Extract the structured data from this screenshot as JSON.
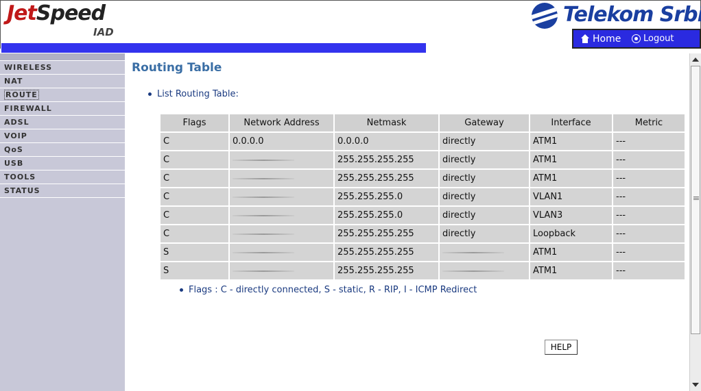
{
  "header": {
    "logo_main_a": "Jet",
    "logo_main_b": "Speed",
    "logo_sub": "IAD",
    "brand": "Telekom Srbija",
    "nav": {
      "home": "Home",
      "logout": "Logout"
    },
    "colors": {
      "bar": "#3333ee",
      "brand": "#1a3fa0",
      "logo_accent": "#c01818"
    }
  },
  "sidebar": {
    "items": [
      {
        "label": "WIRELESS",
        "active": false
      },
      {
        "label": "NAT",
        "active": false
      },
      {
        "label": "ROUTE",
        "active": true
      },
      {
        "label": "FIREWALL",
        "active": false
      },
      {
        "label": "ADSL",
        "active": false
      },
      {
        "label": "VOIP",
        "active": false
      },
      {
        "label": "QoS",
        "active": false
      },
      {
        "label": "USB",
        "active": false
      },
      {
        "label": "TOOLS",
        "active": false
      },
      {
        "label": "STATUS",
        "active": false
      }
    ]
  },
  "main": {
    "title": "Routing Table",
    "list_label": "List Routing Table:",
    "table": {
      "headers": [
        "Flags",
        "Network Address",
        "Netmask",
        "Gateway",
        "Interface",
        "Metric"
      ],
      "rows": [
        [
          "C",
          "0.0.0.0",
          "0.0.0.0",
          "directly",
          "ATM1",
          "---"
        ],
        [
          "C",
          "",
          "255.255.255.255",
          "directly",
          "ATM1",
          "---"
        ],
        [
          "C",
          "",
          "255.255.255.255",
          "directly",
          "ATM1",
          "---"
        ],
        [
          "C",
          "",
          "255.255.255.0",
          "directly",
          "VLAN1",
          "---"
        ],
        [
          "C",
          "",
          "255.255.255.0",
          "directly",
          "VLAN3",
          "---"
        ],
        [
          "C",
          "",
          "255.255.255.255",
          "directly",
          "Loopback",
          "---"
        ],
        [
          "S",
          "",
          "255.255.255.255",
          "",
          "ATM1",
          "---"
        ],
        [
          "S",
          "",
          "255.255.255.255",
          "",
          "ATM1",
          "---"
        ]
      ]
    },
    "flags_note": "Flags :  C - directly connected, S - static, R - RIP, I - ICMP Redirect",
    "help_label": "HELP"
  }
}
